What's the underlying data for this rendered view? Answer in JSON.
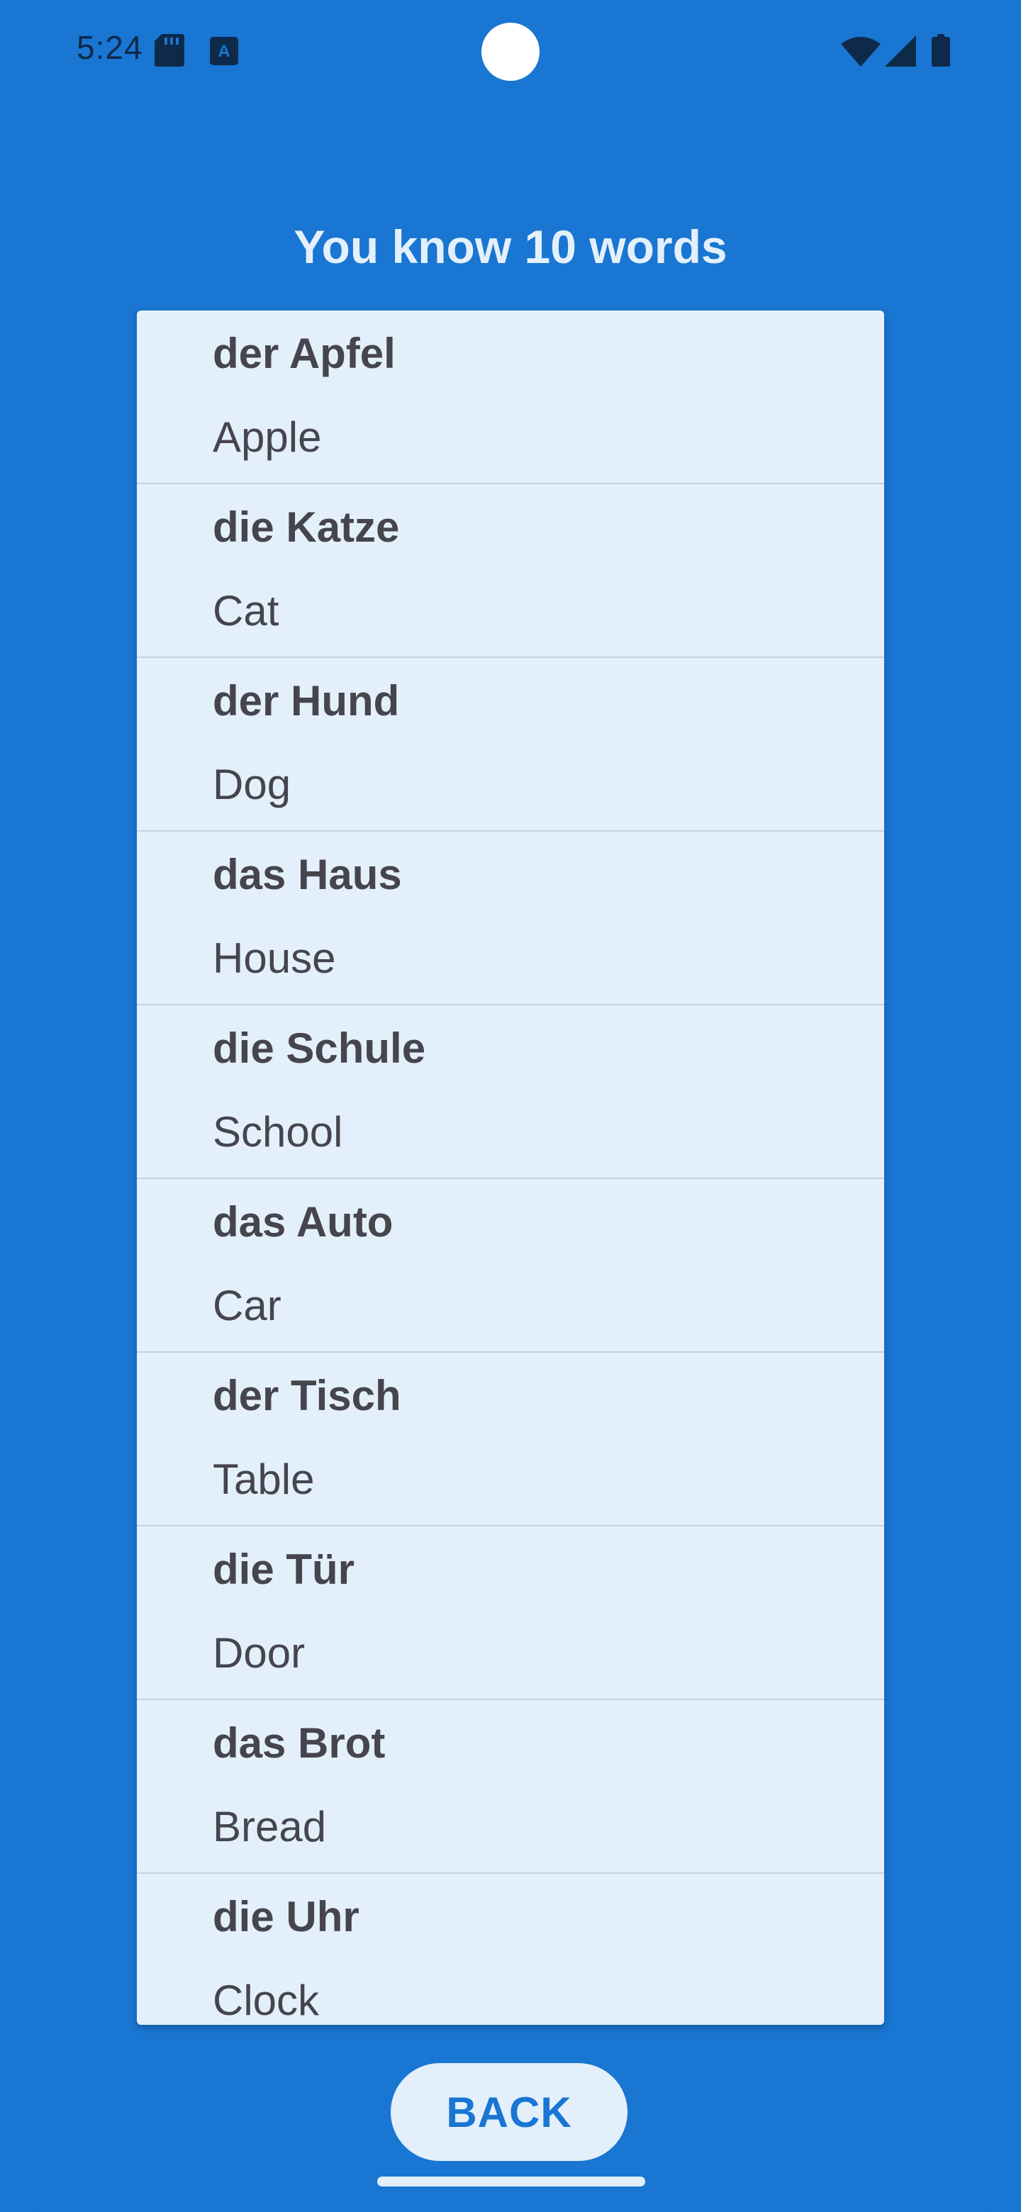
{
  "status_bar": {
    "time": "5:24",
    "icons": [
      "sd-card-icon",
      "a-notification-icon",
      "wifi-icon",
      "cell-signal-icon",
      "battery-icon"
    ]
  },
  "header": {
    "title": "You know 10 words"
  },
  "words": [
    {
      "term": "der Apfel",
      "translation": "Apple"
    },
    {
      "term": "die Katze",
      "translation": "Cat"
    },
    {
      "term": "der Hund",
      "translation": "Dog"
    },
    {
      "term": "das Haus",
      "translation": "House"
    },
    {
      "term": "die Schule",
      "translation": "School"
    },
    {
      "term": "das Auto",
      "translation": "Car"
    },
    {
      "term": "der Tisch",
      "translation": "Table"
    },
    {
      "term": "die Tür",
      "translation": "Door"
    },
    {
      "term": "das Brot",
      "translation": "Bread"
    },
    {
      "term": "die Uhr",
      "translation": "Clock"
    }
  ],
  "actions": {
    "back_label": "BACK"
  },
  "colors": {
    "background": "#1976D2",
    "card": "#E3F0FB",
    "text": "#46454D",
    "divider": "#C4D1DE"
  }
}
